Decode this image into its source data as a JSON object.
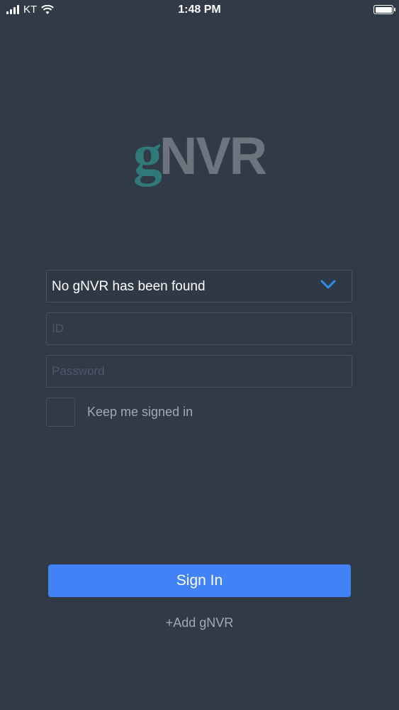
{
  "status_bar": {
    "carrier": "KT",
    "time": "1:48 PM",
    "icons": [
      "signal-icon",
      "wifi-icon",
      "battery-icon"
    ]
  },
  "logo": {
    "g": "g",
    "nvr": "NVR"
  },
  "form": {
    "selector_value": "No gNVR has been found",
    "id_placeholder": "ID",
    "id_value": "",
    "password_placeholder": "Password",
    "password_value": "",
    "keep_signed_in_label": "Keep me signed in",
    "keep_signed_in_checked": false,
    "sign_in_label": "Sign In",
    "add_label": "+Add gNVR"
  },
  "colors": {
    "background": "#313a47",
    "accent": "#4182f7",
    "chevron": "#2f8ee8",
    "logo_g": "#2f7a78",
    "logo_nvr": "#6d747d"
  }
}
